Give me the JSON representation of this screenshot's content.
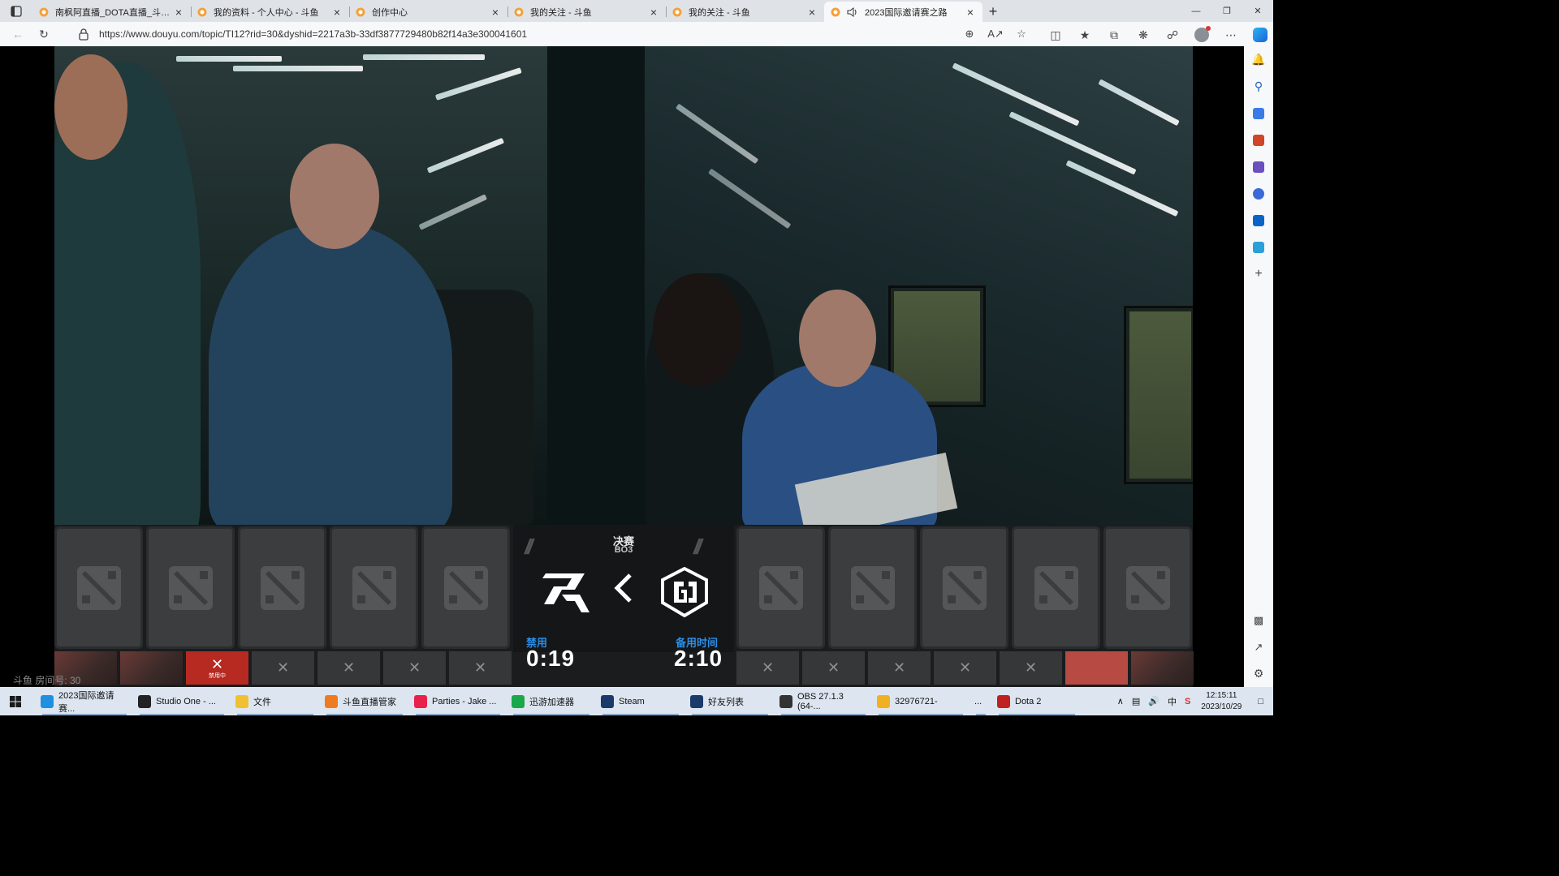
{
  "browser": {
    "tabs": [
      {
        "title": "南枫阿直播_DOTA直播_斗鱼直播",
        "active": false,
        "audio": false
      },
      {
        "title": "我的资料 - 个人中心 - 斗鱼",
        "active": false,
        "audio": false
      },
      {
        "title": "创作中心",
        "active": false,
        "audio": false
      },
      {
        "title": "我的关注 - 斗鱼",
        "active": false,
        "audio": false
      },
      {
        "title": "我的关注 - 斗鱼",
        "active": false,
        "audio": false
      },
      {
        "title": "2023国际邀请赛之路",
        "active": true,
        "audio": true
      }
    ],
    "new_tab_label": "+",
    "url": "https://www.douyu.com/topic/TI12?rid=30&dyshid=2217a3b-33df3877729480b82f14a3e300041601"
  },
  "player": {
    "room_id_label": "斗鱼 房间号: 30"
  },
  "draft": {
    "stage": "决赛",
    "format": "BO3",
    "left_timer_label": "禁用",
    "left_timer": "0:19",
    "right_timer_label": "备用时间",
    "right_timer": "2:10",
    "banning_label": "禁用中",
    "ban_mark": "✕",
    "left_bans": [
      "hero",
      "hero",
      "banning",
      "empty",
      "empty",
      "empty",
      "empty"
    ],
    "right_bans": [
      "empty",
      "empty",
      "empty",
      "empty",
      "empty",
      "red",
      "hero"
    ]
  },
  "taskbar": {
    "items": [
      {
        "label": "2023国际邀请赛...",
        "color": "#1f8fe0"
      },
      {
        "label": "Studio One - ...",
        "color": "#222222"
      },
      {
        "label": "文件",
        "color": "#f0c030"
      },
      {
        "label": "斗鱼直播管家",
        "color": "#f07a20"
      },
      {
        "label": "Parties - Jake ...",
        "color": "#e8204a"
      },
      {
        "label": "迅游加速器",
        "color": "#19a84a"
      },
      {
        "label": "Steam",
        "color": "#1a3a6a"
      },
      {
        "label": "好友列表",
        "color": "#1a3a6a"
      },
      {
        "label": "OBS 27.1.3 (64-...",
        "color": "#333333"
      },
      {
        "label": "32976721-",
        "color": "#f0b020"
      },
      {
        "label": "...",
        "color": ""
      },
      {
        "label": "Dota 2",
        "color": "#c02020"
      }
    ],
    "ime": "中",
    "time": "12:15:11",
    "date": "2023/10/29"
  }
}
